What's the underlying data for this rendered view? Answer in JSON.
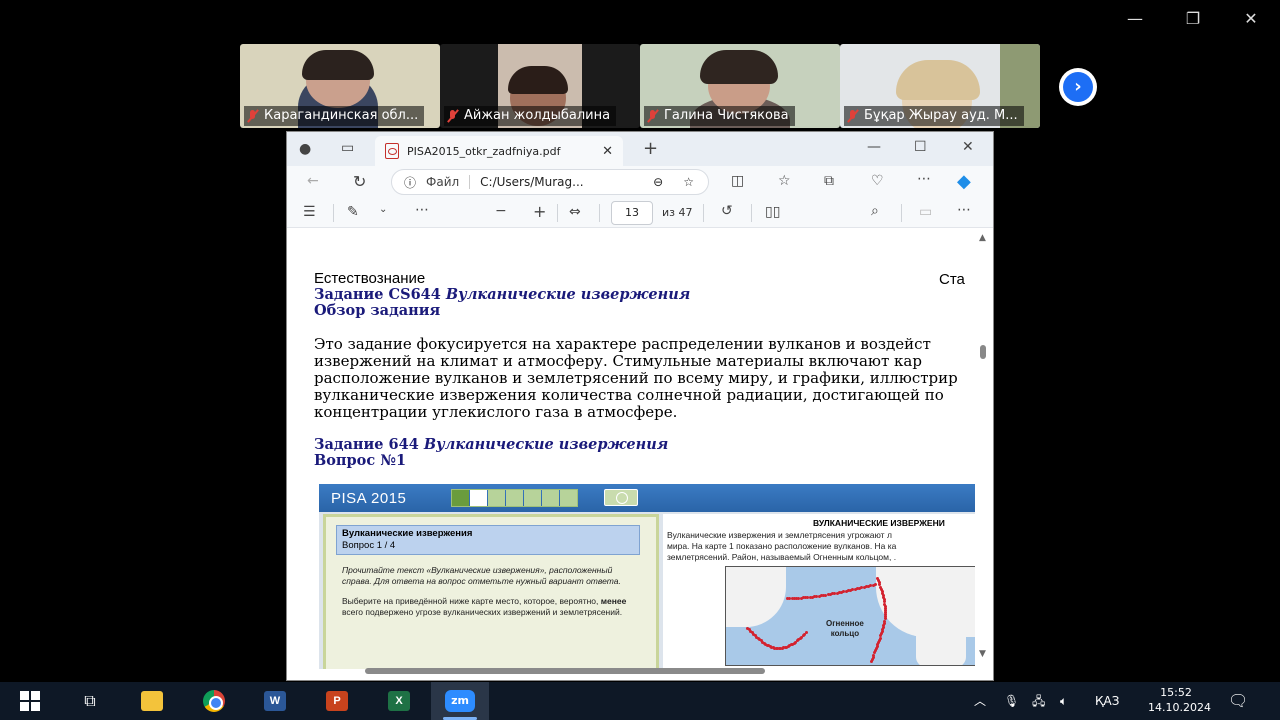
{
  "participants": [
    {
      "name": "Карагандинская обл...",
      "bg": "#d8d2b8"
    },
    {
      "name": "Айжан жолдыбалина",
      "bg": "#c9b9aa"
    },
    {
      "name": "Галина Чистякова",
      "bg": "#b9c6b0"
    },
    {
      "name": "Бұқар Жырау ауд. М...",
      "bg": "#dfe3e6"
    }
  ],
  "browser": {
    "tab_title": "PISA2015_otkr_zadfniya.pdf",
    "address_label": "Файл",
    "address_value": "C:/Users/Murag...",
    "page_number": "13",
    "page_total": "из 47"
  },
  "document": {
    "subject": "Естествознание",
    "subject_right": "Ста",
    "task_heading_1_bold": "Задание CS644 ",
    "task_heading_1_italic": "Вулканические извержения",
    "overview": "Обзор задания",
    "paragraph_lines": [
      "Это задание фокусируется на характере распределении вулканов и воздейст",
      "извержений на климат и атмосферу. Стимульные материалы включают кар",
      "расположение вулканов и землетрясений по всему миру, и графики, иллюстрир",
      "вулканические извержения количества солнечной радиации, достигающей по",
      "концентрации углекислого газа в атмосфере."
    ],
    "task_heading_2_bold": "Задание 644 ",
    "task_heading_2_italic": "Вулканические извержения",
    "question": "Вопрос №1"
  },
  "pisa": {
    "title": "PISA 2015",
    "progress": {
      "done": 1,
      "current": 1,
      "total": 7
    },
    "question_title": "Вулканические извержения",
    "question_number": "Вопрос 1 / 4",
    "instruction_italic": "Прочитайте текст «Вулканические извержения», расположенный справа. Для ответа на вопрос отметьте нужный вариант ответа.",
    "question_text_1": "Выберите на приведённой ниже карте место, которое, вероятно, ",
    "question_text_bold": "менее",
    "question_text_2": " всего подвержено угрозе вулканических извержений и землетрясений.",
    "right_title": "ВУЛКАНИЧЕСКИЕ ИЗВЕРЖЕНИ",
    "right_lines": [
      "Вулканические извержения и землетрясения угрожают л",
      "мира. На карте 1 показано расположение вулканов. На ка",
      "землетрясений. Район, называемый Огненным кольцом, ."
    ],
    "map_label_1": "Огненное",
    "map_label_2": "кольцо"
  },
  "taskbar": {
    "zoom_label": "zm",
    "word_label": "W",
    "ppt_label": "P",
    "excel_label": "X",
    "lang": "ҚАЗ",
    "time": "15:52",
    "date": "14.10.2024"
  },
  "colors": {
    "accent": "#1d6ef5",
    "heading_blue": "#1a1a7a",
    "pisa_blue": "#2a64a8"
  }
}
